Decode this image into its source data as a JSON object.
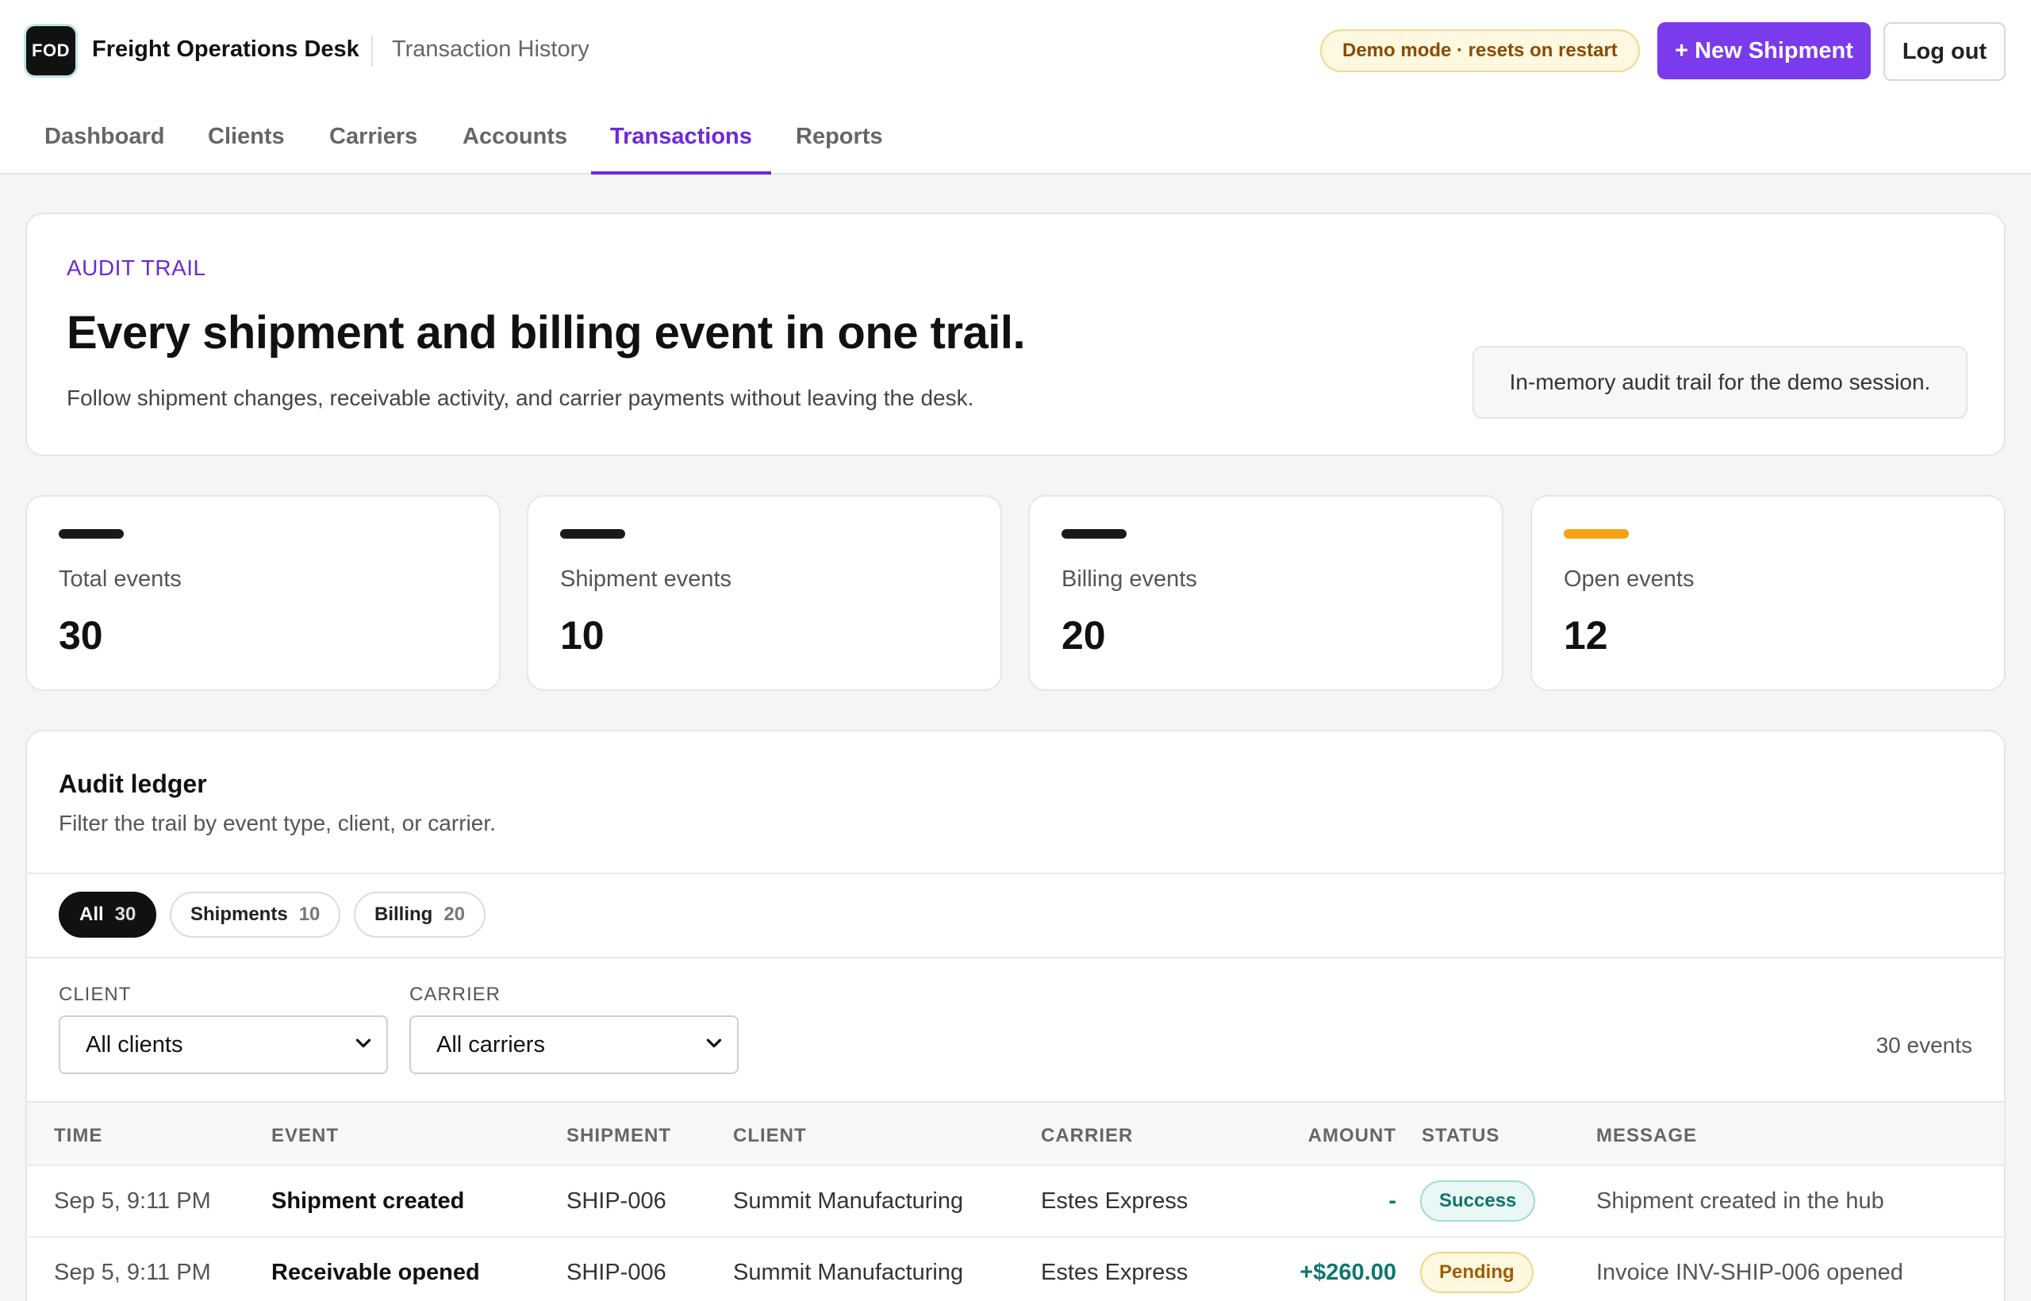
{
  "header": {
    "logo": "FOD",
    "app_name": "Freight Operations Desk",
    "page_name": "Transaction History",
    "demo_badge": "Demo mode · resets on restart",
    "new_button": "+ New Shipment",
    "logout_button": "Log out"
  },
  "nav": {
    "tabs": [
      {
        "label": "Dashboard",
        "active": false
      },
      {
        "label": "Clients",
        "active": false
      },
      {
        "label": "Carriers",
        "active": false
      },
      {
        "label": "Accounts",
        "active": false
      },
      {
        "label": "Transactions",
        "active": true
      },
      {
        "label": "Reports",
        "active": false
      }
    ]
  },
  "hero": {
    "kicker": "AUDIT TRAIL",
    "title": "Every shipment and billing event in one trail.",
    "subtitle": "Follow shipment changes, receivable activity, and carrier payments without leaving the desk.",
    "note": "In-memory audit trail for the demo session."
  },
  "stats": [
    {
      "label": "Total events",
      "value": "30",
      "color": "#1a1a1a"
    },
    {
      "label": "Shipment events",
      "value": "10",
      "color": "#1a1a1a"
    },
    {
      "label": "Billing events",
      "value": "20",
      "color": "#1a1a1a"
    },
    {
      "label": "Open events",
      "value": "12",
      "color": "#f5a114"
    }
  ],
  "ledger": {
    "title": "Audit ledger",
    "subtitle": "Filter the trail by event type, client, or carrier.",
    "pills": [
      {
        "label": "All",
        "count": "30",
        "active": true
      },
      {
        "label": "Shipments",
        "count": "10",
        "active": false
      },
      {
        "label": "Billing",
        "count": "20",
        "active": false
      }
    ],
    "client_filter": {
      "label": "CLIENT",
      "value": "All clients"
    },
    "carrier_filter": {
      "label": "CARRIER",
      "value": "All carriers"
    },
    "events_count": "30 events",
    "columns": [
      "TIME",
      "EVENT",
      "SHIPMENT",
      "CLIENT",
      "CARRIER",
      "AMOUNT",
      "STATUS",
      "MESSAGE"
    ],
    "rows": [
      {
        "time": "Sep 5, 9:11 PM",
        "event": "Shipment created",
        "shipment": "SHIP-006",
        "client": "Summit Manufacturing",
        "carrier": "Estes Express",
        "amount": "-",
        "status": "Success",
        "status_kind": "success",
        "message": "Shipment created in the hub"
      },
      {
        "time": "Sep 5, 9:11 PM",
        "event": "Receivable opened",
        "shipment": "SHIP-006",
        "client": "Summit Manufacturing",
        "carrier": "Estes Express",
        "amount": "+$260.00",
        "status": "Pending",
        "status_kind": "pending",
        "message": "Invoice INV-SHIP-006 opened"
      }
    ]
  }
}
